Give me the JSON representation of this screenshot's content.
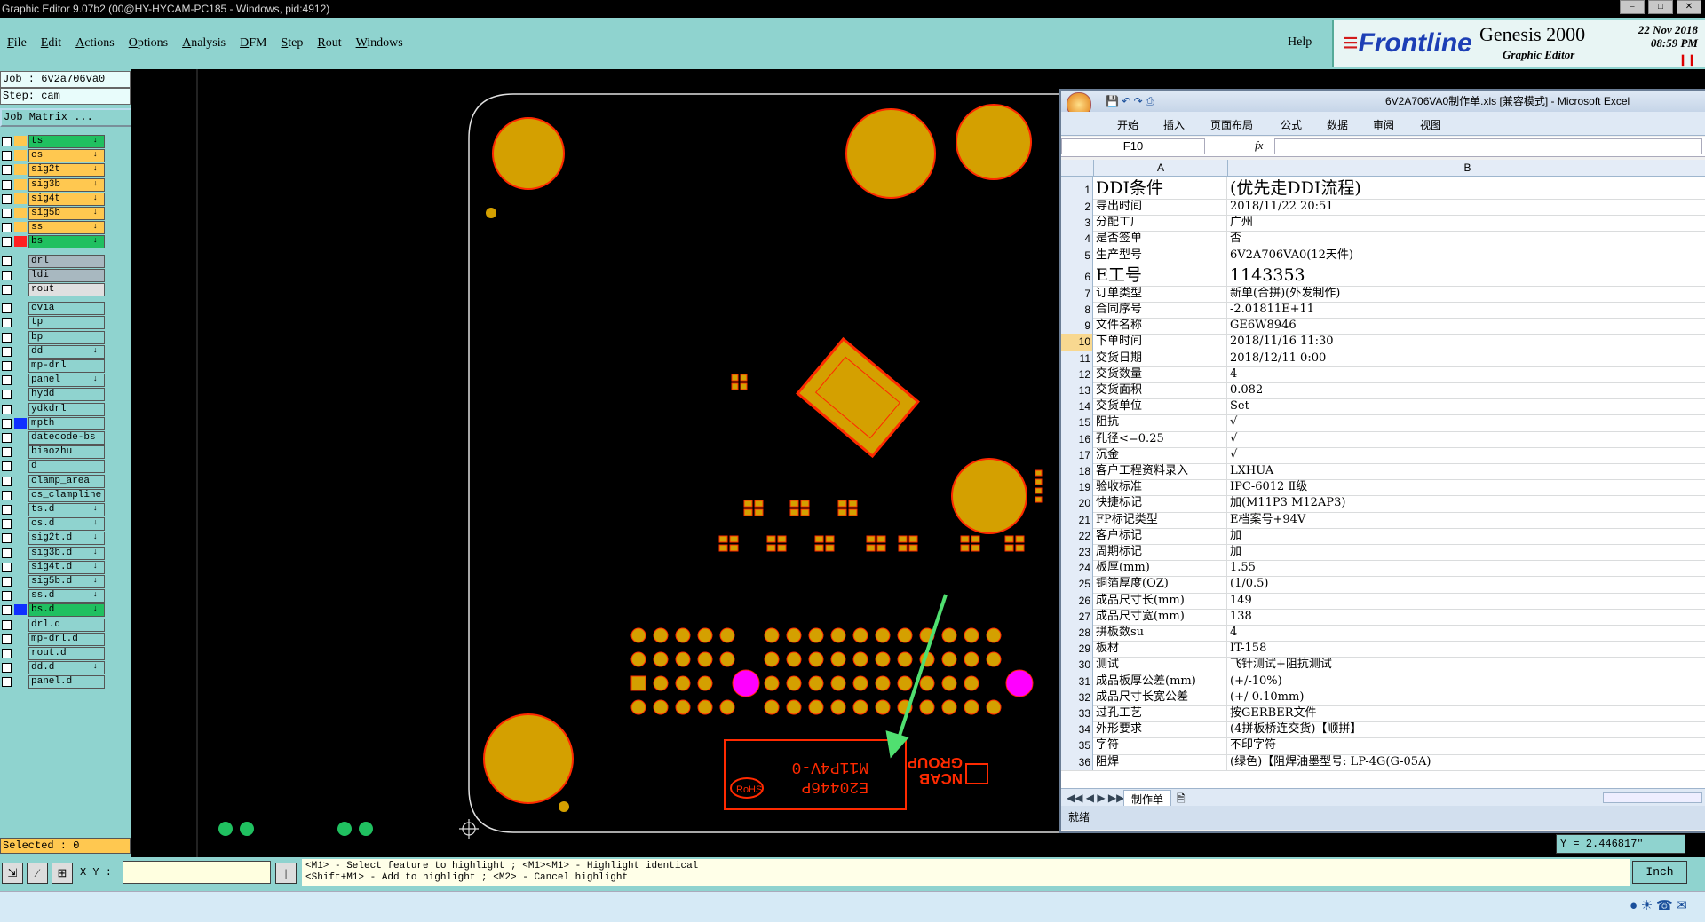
{
  "window": {
    "title": "Graphic Editor 9.07b2 (00@HY-HYCAM-PC185 - Windows, pid:4912)"
  },
  "menu": {
    "items": [
      "File",
      "Edit",
      "Actions",
      "Options",
      "Analysis",
      "DFM",
      "Step",
      "Rout",
      "Windows"
    ],
    "help": "Help"
  },
  "branding": {
    "frontline": "Frontline",
    "genesis": "Genesis 2000",
    "subtitle": "Graphic Editor",
    "date": "22 Nov 2018",
    "time": "08:59 PM"
  },
  "job": {
    "job_line": "Job : 6v2a706va0",
    "step_line": "Step: cam",
    "matrix_button": "Job Matrix ..."
  },
  "layers": [
    {
      "name": "ts",
      "color": "#ffc850",
      "bg": "#20c060",
      "arrow": true
    },
    {
      "name": "cs",
      "color": "#ffc850",
      "bg": "#ffc850",
      "arrow": true
    },
    {
      "name": "sig2t",
      "color": "#ffc850",
      "bg": "#ffc850",
      "arrow": true
    },
    {
      "name": "sig3b",
      "color": "#ffc850",
      "bg": "#ffc850",
      "arrow": true
    },
    {
      "name": "sig4t",
      "color": "#ffc850",
      "bg": "#ffc850",
      "arrow": true
    },
    {
      "name": "sig5b",
      "color": "#ffc850",
      "bg": "#ffc850",
      "arrow": true
    },
    {
      "name": "ss",
      "color": "#ffc850",
      "bg": "#ffc850",
      "arrow": true
    },
    {
      "name": "bs",
      "color": "#ff2020",
      "bg": "#20c060",
      "arrow": true
    },
    {
      "name": "drl",
      "color": "",
      "bg": "#a8b8c0",
      "arrow": false
    },
    {
      "name": "ldi",
      "color": "",
      "bg": "#a8b8c0",
      "arrow": false
    },
    {
      "name": "rout",
      "color": "",
      "bg": "#e0e0e0",
      "arrow": false
    },
    {
      "name": "cvia",
      "color": "",
      "bg": "#8fd3cf",
      "arrow": false
    },
    {
      "name": "tp",
      "color": "",
      "bg": "#8fd3cf",
      "arrow": false
    },
    {
      "name": "bp",
      "color": "",
      "bg": "#8fd3cf",
      "arrow": false
    },
    {
      "name": "dd",
      "color": "",
      "bg": "#8fd3cf",
      "arrow": true
    },
    {
      "name": "mp-drl",
      "color": "",
      "bg": "#8fd3cf",
      "arrow": false
    },
    {
      "name": "panel",
      "color": "",
      "bg": "#8fd3cf",
      "arrow": true
    },
    {
      "name": "hydd",
      "color": "",
      "bg": "#8fd3cf",
      "arrow": false
    },
    {
      "name": "ydkdrl",
      "color": "",
      "bg": "#8fd3cf",
      "arrow": false
    },
    {
      "name": "mpth",
      "color": "#1030ff",
      "bg": "#8fd3cf",
      "arrow": false
    },
    {
      "name": "datecode-bs",
      "color": "",
      "bg": "#8fd3cf",
      "arrow": false
    },
    {
      "name": "biaozhu",
      "color": "",
      "bg": "#8fd3cf",
      "arrow": false
    },
    {
      "name": "d",
      "color": "",
      "bg": "#8fd3cf",
      "arrow": false
    },
    {
      "name": "clamp_area",
      "color": "",
      "bg": "#8fd3cf",
      "arrow": false
    },
    {
      "name": "cs_clampline",
      "color": "",
      "bg": "#8fd3cf",
      "arrow": false
    },
    {
      "name": "ts.d",
      "color": "",
      "bg": "#8fd3cf",
      "arrow": true
    },
    {
      "name": "cs.d",
      "color": "",
      "bg": "#8fd3cf",
      "arrow": true
    },
    {
      "name": "sig2t.d",
      "color": "",
      "bg": "#8fd3cf",
      "arrow": true
    },
    {
      "name": "sig3b.d",
      "color": "",
      "bg": "#8fd3cf",
      "arrow": true
    },
    {
      "name": "sig4t.d",
      "color": "",
      "bg": "#8fd3cf",
      "arrow": true
    },
    {
      "name": "sig5b.d",
      "color": "",
      "bg": "#8fd3cf",
      "arrow": true
    },
    {
      "name": "ss.d",
      "color": "",
      "bg": "#8fd3cf",
      "arrow": true
    },
    {
      "name": "bs.d",
      "color": "#1030ff",
      "bg": "#20c060",
      "arrow": true
    },
    {
      "name": "drl.d",
      "color": "",
      "bg": "#8fd3cf",
      "arrow": false
    },
    {
      "name": "mp-drl.d",
      "color": "",
      "bg": "#8fd3cf",
      "arrow": false
    },
    {
      "name": "rout.d",
      "color": "",
      "bg": "#8fd3cf",
      "arrow": false
    },
    {
      "name": "dd.d",
      "color": "",
      "bg": "#8fd3cf",
      "arrow": true
    },
    {
      "name": "panel.d",
      "color": "",
      "bg": "#8fd3cf",
      "arrow": false
    }
  ],
  "status": {
    "selected": "Selected : 0",
    "xy_label": "X Y :",
    "hint_line1": "<M1> - Select feature to highlight ; <M1><M1> - Highlight identical",
    "hint_line2": "<Shift+M1> - Add to highlight ; <M2> - Cancel highlight",
    "y_coord": "Y = 2.446817\"",
    "units": "Inch"
  },
  "pcb_text": {
    "label1": "E20446P",
    "label2": "M11P4V-0",
    "logo": "RoHS",
    "brand1": "NCAB",
    "brand2": "GROUP"
  },
  "excel": {
    "title": "6V2A706VA0制作单.xls [兼容模式] - Microsoft Excel",
    "tabs": [
      "开始",
      "插入",
      "页面布局",
      "公式",
      "数据",
      "审阅",
      "视图"
    ],
    "name_box": "F10",
    "fx": "fx",
    "col_a": "A",
    "col_b": "B",
    "rows": [
      {
        "n": "1",
        "a": "DDI条件",
        "b": "(优先走DDI流程)"
      },
      {
        "n": "2",
        "a": "导出时间",
        "b": "2018/11/22 20:51"
      },
      {
        "n": "3",
        "a": "分配工厂",
        "b": "广州"
      },
      {
        "n": "4",
        "a": "是否签单",
        "b": "否"
      },
      {
        "n": "5",
        "a": "生产型号",
        "b": "6V2A706VA0(12天件)"
      },
      {
        "n": "6",
        "a": "E工号",
        "b": "1143353"
      },
      {
        "n": "7",
        "a": "订单类型",
        "b": "新单(合拼)(外发制作)"
      },
      {
        "n": "8",
        "a": "合同序号",
        "b": "-2.01811E+11"
      },
      {
        "n": "9",
        "a": "文件名称",
        "b": "GE6W8946"
      },
      {
        "n": "10",
        "a": "下单时间",
        "b": "2018/11/16 11:30"
      },
      {
        "n": "11",
        "a": "交货日期",
        "b": "2018/12/11 0:00"
      },
      {
        "n": "12",
        "a": "交货数量",
        "b": "4"
      },
      {
        "n": "13",
        "a": "交货面积",
        "b": "0.082"
      },
      {
        "n": "14",
        "a": "交货单位",
        "b": "Set"
      },
      {
        "n": "15",
        "a": "阻抗",
        "b": "√"
      },
      {
        "n": "16",
        "a": "孔径<=0.25",
        "b": "√"
      },
      {
        "n": "17",
        "a": "沉金",
        "b": "√"
      },
      {
        "n": "18",
        "a": "客户工程资料录入",
        "b": "LXHUA"
      },
      {
        "n": "19",
        "a": "验收标准",
        "b": "IPC-6012 Ⅱ级"
      },
      {
        "n": "20",
        "a": "快捷标记",
        "b": "加(M11P3 M12AP3)"
      },
      {
        "n": "21",
        "a": "FP标记类型",
        "b": "E档案号+94V"
      },
      {
        "n": "22",
        "a": "客户标记",
        "b": "加"
      },
      {
        "n": "23",
        "a": "周期标记",
        "b": "加"
      },
      {
        "n": "24",
        "a": "板厚(mm)",
        "b": "1.55"
      },
      {
        "n": "25",
        "a": "铜箔厚度(OZ)",
        "b": "(1/0.5)"
      },
      {
        "n": "26",
        "a": "成品尺寸长(mm)",
        "b": "149"
      },
      {
        "n": "27",
        "a": "成品尺寸宽(mm)",
        "b": "138"
      },
      {
        "n": "28",
        "a": "拼板数su",
        "b": "4"
      },
      {
        "n": "29",
        "a": "板材",
        "b": "IT-158"
      },
      {
        "n": "30",
        "a": "测试",
        "b": "飞针测试+阻抗测试"
      },
      {
        "n": "31",
        "a": "成品板厚公差(mm)",
        "b": "(+/-10%)"
      },
      {
        "n": "32",
        "a": "成品尺寸长宽公差",
        "b": "(+/-0.10mm)"
      },
      {
        "n": "33",
        "a": "过孔工艺",
        "b": "按GERBER文件"
      },
      {
        "n": "34",
        "a": "外形要求",
        "b": "(4拼板桥连交货)【顺拼】"
      },
      {
        "n": "35",
        "a": "字符",
        "b": "不印字符"
      },
      {
        "n": "36",
        "a": "阻焊",
        "b": "(绿色)【阻焊油墨型号: LP-4G(G-05A)"
      }
    ],
    "sheet_tab": "制作单",
    "status": "就绪"
  },
  "colors": {
    "panel_bg": "#8fd3cf",
    "pad": "#d4a000",
    "pad_outline": "#ff2a00",
    "magenta_pad": "#ff00ff",
    "arrow": "#50e070"
  }
}
